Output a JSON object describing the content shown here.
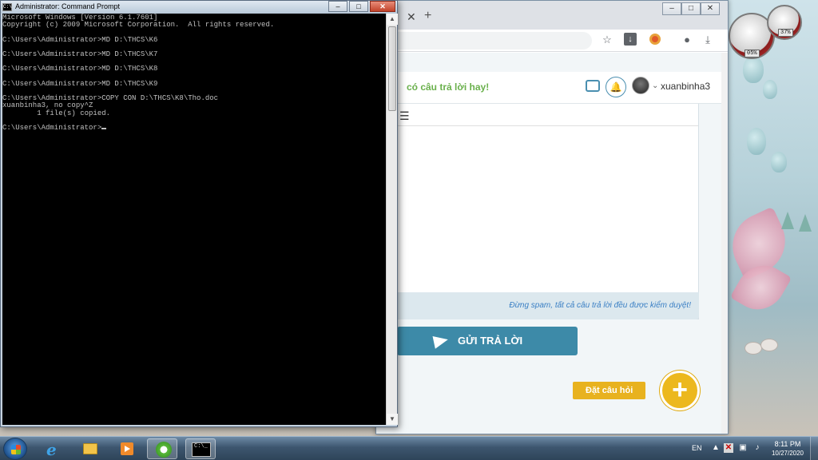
{
  "cmd_window": {
    "title": "Administrator: Command Prompt",
    "icon_label": "C:\\",
    "lines": [
      "Microsoft Windows [Version 6.1.7601]",
      "Copyright (c) 2009 Microsoft Corporation.  All rights reserved.",
      "",
      "C:\\Users\\Administrator>MD D:\\THCS\\K6",
      "",
      "C:\\Users\\Administrator>MD D:\\THCS\\K7",
      "",
      "C:\\Users\\Administrator>MD D:\\THCS\\K8",
      "",
      "C:\\Users\\Administrator>MD D:\\THCS\\K9",
      "",
      "C:\\Users\\Administrator>COPY CON D:\\THCS\\K8\\Tho.doc",
      "xuanbinha3, no copy^Z",
      "        1 file(s) copied.",
      "",
      "C:\\Users\\Administrator>"
    ]
  },
  "browser": {
    "tab_close_glyph": "✕",
    "new_tab_glyph": "+",
    "site": {
      "tagline": "có câu trả lời hay!",
      "username": "xuanbinha3",
      "notice": "Đừng spam, tất cả câu trả lời đều được kiểm duyệt!",
      "submit_label": "GỬI TRẢ LỜI",
      "ask_label": "Đặt câu hỏi",
      "ask_glyph": "+"
    }
  },
  "gadgets": {
    "cpu_readout": "05%",
    "mem_readout": "37%"
  },
  "taskbar": {
    "language": "EN",
    "clock_time": "8:11 PM",
    "clock_date": "10/27/2020",
    "cmd_icon_label": "C:\\_"
  },
  "colors": {
    "accent_green": "#6ab04c",
    "accent_blue": "#3d8aa8",
    "accent_yellow": "#ecb81e",
    "notice_blue": "#3a7fc4"
  }
}
